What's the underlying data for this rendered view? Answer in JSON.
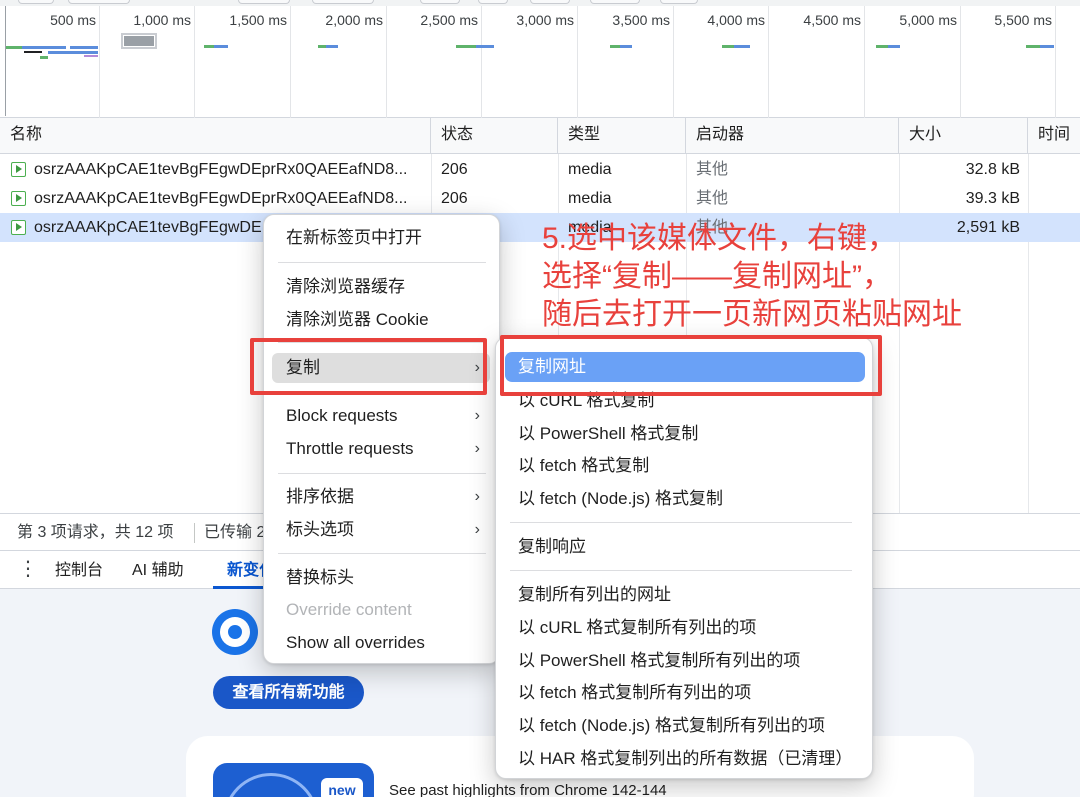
{
  "timeline": {
    "ticks": [
      "500 ms",
      "1,000 ms",
      "1,500 ms",
      "2,000 ms",
      "2,500 ms",
      "3,000 ms",
      "3,500 ms",
      "4,000 ms",
      "4,500 ms",
      "5,000 ms",
      "5,500 ms"
    ]
  },
  "table": {
    "headers": {
      "name": "名称",
      "status": "状态",
      "type": "类型",
      "initiator": "启动器",
      "size": "大小",
      "time": "时间"
    },
    "rows": [
      {
        "name": "osrzAAAKpCAE1tevBgFEgwDEprRx0QAEEafND8...",
        "status": "206",
        "type": "media",
        "initiator": "其他",
        "size": "32.8 kB"
      },
      {
        "name": "osrzAAAKpCAE1tevBgFEgwDEprRx0QAEEafND8...",
        "status": "206",
        "type": "media",
        "initiator": "其他",
        "size": "39.3 kB"
      },
      {
        "name": "osrzAAAKpCAE1tevBgFEgwDE",
        "status": "",
        "type": "media",
        "initiator": "其他",
        "size": "2,591 kB"
      }
    ]
  },
  "statusbar": {
    "requests": "第 3 项请求，共 12 项",
    "transferred": "已传输 2"
  },
  "drawer": {
    "tabs": [
      "控制台",
      "AI 辅助",
      "新变化"
    ],
    "cta_button": "查看所有新功能",
    "badge": "new",
    "card_text": "See past highlights from Chrome 142-144"
  },
  "context_menu": {
    "open_new_tab": "在新标签页中打开",
    "clear_cache": "清除浏览器缓存",
    "clear_cookies": "清除浏览器 Cookie",
    "copy": "复制",
    "block_requests": "Block requests",
    "throttle_requests": "Throttle requests",
    "sort_by": "排序依据",
    "header_options": "标头选项",
    "replace_headers": "替换标头",
    "override_content": "Override content",
    "show_all_overrides": "Show all overrides"
  },
  "copy_submenu": {
    "copy_url": "复制网址",
    "copy_as_curl": "以 cURL 格式复制",
    "copy_as_powershell": "以 PowerShell 格式复制",
    "copy_as_fetch": "以 fetch 格式复制",
    "copy_as_fetch_node": "以 fetch (Node.js) 格式复制",
    "copy_response": "复制响应",
    "copy_all_urls": "复制所有列出的网址",
    "copy_all_as_curl": "以 cURL 格式复制所有列出的项",
    "copy_all_as_powershell": "以 PowerShell 格式复制所有列出的项",
    "copy_all_as_fetch": "以 fetch 格式复制所有列出的项",
    "copy_all_as_fetch_node": "以 fetch (Node.js) 格式复制所有列出的项",
    "copy_all_as_har": "以 HAR 格式复制列出的所有数据（已清理）"
  },
  "annotation": {
    "line1": "5.选中该媒体文件，右键，",
    "line2": "选择“复制——复制网址”，",
    "line3": "随后去打开一页新网页粘贴网址"
  },
  "colors": {
    "annotation_red": "#e8413c",
    "selected_row": "#d3e3fd",
    "submenu_highlight": "#6aa1f6",
    "accent_blue": "#0b57d0"
  }
}
